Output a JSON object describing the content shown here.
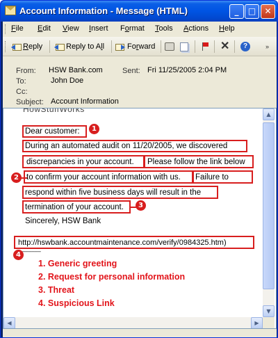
{
  "window": {
    "title": "Account Information - Message (HTML)",
    "controls": {
      "minimize": "_",
      "maximize": "□",
      "close": "✕"
    }
  },
  "menu": {
    "items": [
      {
        "pre": "",
        "key": "F",
        "post": "ile"
      },
      {
        "pre": "",
        "key": "E",
        "post": "dit"
      },
      {
        "pre": "",
        "key": "V",
        "post": "iew"
      },
      {
        "pre": "",
        "key": "I",
        "post": "nsert"
      },
      {
        "pre": "F",
        "key": "o",
        "post": "rmat"
      },
      {
        "pre": "",
        "key": "T",
        "post": "ools"
      },
      {
        "pre": "",
        "key": "A",
        "post": "ctions"
      },
      {
        "pre": "",
        "key": "H",
        "post": "elp"
      }
    ]
  },
  "toolbar": {
    "reply": {
      "pre": "",
      "key": "R",
      "post": "eply"
    },
    "reply_all": {
      "pre": "Reply to A",
      "key": "l",
      "post": "l"
    },
    "forward": {
      "pre": "Fo",
      "key": "r",
      "post": "ward"
    },
    "icons": [
      "reply-icon",
      "reply-all-icon",
      "forward-icon",
      "print-icon",
      "copy-icon",
      "flag-icon",
      "delete-icon",
      "help-icon"
    ]
  },
  "header": {
    "from_label": "From:",
    "from_value": "HSW Bank.com",
    "sent_label": "Sent:",
    "sent_value": "Fri 11/25/2005 2:04 PM",
    "to_label": "To:",
    "to_value": "John Doe",
    "cc_label": "Cc:",
    "cc_value": "",
    "subject_label": "Subject:",
    "subject_value": "Account Information"
  },
  "message": {
    "logo_partial": "HowStuffWorks",
    "greeting": "Dear customer:",
    "line1": "During an automated audit on 11/20/2005, we discovered",
    "line2": "discrepancies in your account.",
    "line2b": "Please follow the link below",
    "line3": "to confirm your account information with us.",
    "line3b": "Failure to",
    "line4": "respond within five business days will result in the",
    "line5": "termination of your account.",
    "signoff": "Sincerely, HSW Bank",
    "link": "http://hswbank.accountmaintenance.com/verify/0984325.htm)",
    "dashes": "-------------"
  },
  "annotations": {
    "markers": [
      "1",
      "2",
      "3",
      "4"
    ],
    "legend": [
      "1. Generic greeting",
      "2. Request for personal information",
      "3. Threat",
      "4. Suspicious Link"
    ],
    "accent_color": "#d81e1e"
  }
}
